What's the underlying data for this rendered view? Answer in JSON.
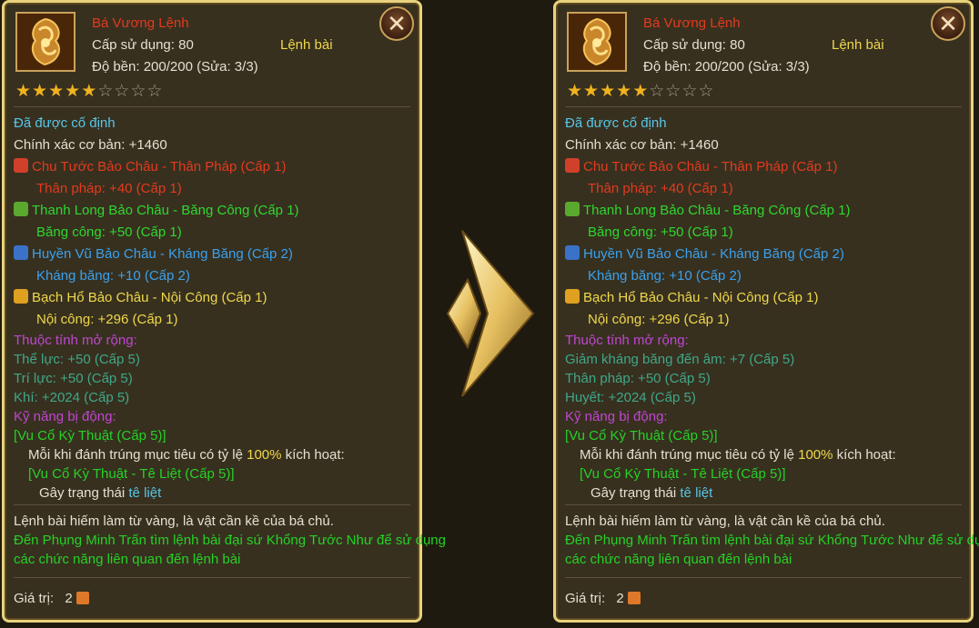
{
  "left": {
    "item_name": "Bá Vương Lệnh",
    "req_level": "Cấp sử dụng: 80",
    "item_type": "Lệnh bài",
    "durability": "Độ bền: 200/200 (Sửa: 3/3)",
    "stars_filled": 5,
    "stars_total": 9,
    "fixed_header": "Đã được cố định",
    "base_stat": "Chính xác cơ bản: +1460",
    "gems": [
      {
        "icon": "red-gem-icon",
        "name": "Chu Tước Bảo Châu - Thân Pháp (Cấp 1)",
        "stat": "Thân pháp: +40 (Cấp 1)"
      },
      {
        "icon": "green-gem-icon",
        "name": "Thanh Long Bảo Châu - Băng Công (Cấp 1)",
        "stat": "Băng công: +50 (Cấp 1)"
      },
      {
        "icon": "blue-gem-icon",
        "name": "Huyền Vũ Bảo Châu - Kháng Băng (Cấp 2)",
        "stat": "Kháng băng: +10 (Cấp 2)"
      },
      {
        "icon": "yellow-gem-icon",
        "name": "Bạch Hổ Bảo Châu - Nội Công (Cấp 1)",
        "stat": "Nội công: +296 (Cấp 1)"
      }
    ],
    "ext_header": "Thuộc tính mở rộng:",
    "ext_attrs": [
      "Thể lực: +50 (Cấp 5)",
      "Trí lực: +50 (Cấp 5)",
      "Khí: +2024 (Cấp 5)"
    ],
    "passive_header": "Kỹ năng bị động:",
    "passive_name": "[Vu Cổ Kỳ Thuật (Cấp 5)]",
    "passive_desc_a": "Mỗi khi đánh trúng mục tiêu có tỷ lệ ",
    "passive_pct": "100%",
    "passive_desc_b": " kích hoạt:",
    "passive_sub": "[Vu Cổ Kỳ Thuật - Tê Liệt (Cấp 5)]",
    "passive_effect_a": "Gây trạng thái ",
    "passive_effect_b": "tê liệt",
    "desc1": "Lệnh bài hiếm làm từ vàng, là vật cần kề của bá chủ.",
    "desc2": "Đến Phụng Minh Trấn tìm lệnh bài đại sứ Khổng Tước Như để sử dụng",
    "desc3": "các chức năng liên quan đến lệnh bài",
    "value_label": "Giá trị:",
    "value": "2"
  },
  "right": {
    "item_name": "Bá Vương Lệnh",
    "req_level": "Cấp sử dụng: 80",
    "item_type": "Lệnh bài",
    "durability": "Độ bền: 200/200 (Sửa: 3/3)",
    "stars_filled": 5,
    "stars_total": 9,
    "fixed_header": "Đã được cố định",
    "base_stat": "Chính xác cơ bản: +1460",
    "gems": [
      {
        "icon": "red-gem-icon",
        "name": "Chu Tước Bảo Châu - Thân Pháp (Cấp 1)",
        "stat": "Thân pháp: +40 (Cấp 1)"
      },
      {
        "icon": "green-gem-icon",
        "name": "Thanh Long Bảo Châu - Băng Công (Cấp 1)",
        "stat": "Băng công: +50 (Cấp 1)"
      },
      {
        "icon": "blue-gem-icon",
        "name": "Huyền Vũ Bảo Châu - Kháng Băng (Cấp 2)",
        "stat": "Kháng băng: +10 (Cấp 2)"
      },
      {
        "icon": "yellow-gem-icon",
        "name": "Bạch Hổ Bảo Châu - Nội Công (Cấp 1)",
        "stat": "Nội công: +296 (Cấp 1)"
      }
    ],
    "ext_header": "Thuộc tính mở rộng:",
    "ext_attrs": [
      "Giảm kháng băng đến âm: +7 (Cấp 5)",
      "Thân pháp: +50 (Cấp 5)",
      "Huyết: +2024 (Cấp 5)"
    ],
    "passive_header": "Kỹ năng bị động:",
    "passive_name": "[Vu Cổ Kỳ Thuật (Cấp 5)]",
    "passive_desc_a": "Mỗi khi đánh trúng mục tiêu có tỷ lệ ",
    "passive_pct": "100%",
    "passive_desc_b": " kích hoạt:",
    "passive_sub": "[Vu Cổ Kỳ Thuật - Tê Liệt (Cấp 5)]",
    "passive_effect_a": "Gây trạng thái ",
    "passive_effect_b": "tê liệt",
    "desc1": "Lệnh bài hiếm làm từ vàng, là vật cần kề của bá chủ.",
    "desc2": "Đến Phụng Minh Trấn tìm lệnh bài đại sứ Khổng Tước Như để sử dụng",
    "desc3": "các chức năng liên quan đến lệnh bài",
    "value_label": "Giá trị:",
    "value": "2"
  },
  "close_glyph": "✕",
  "colors": {
    "panel_border": "#e9d27e",
    "panel_bg": "#37301f",
    "red_gem": "#d0402a",
    "green_gem": "#5ba82e",
    "blue_gem": "#3a72c8",
    "yellow_gem": "#e0a020"
  }
}
